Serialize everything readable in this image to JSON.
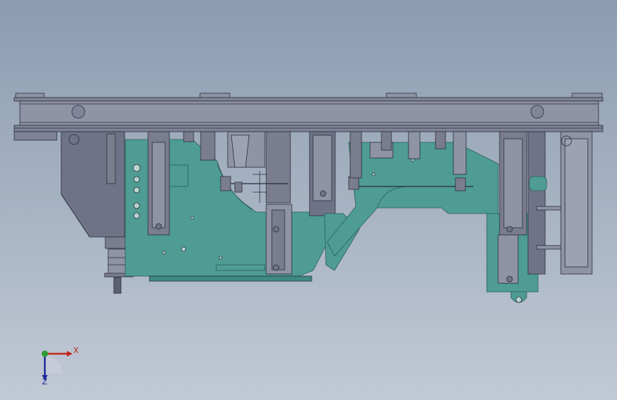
{
  "triad": {
    "x_label": "X",
    "z_label": "Z",
    "x_color": "#c0281e",
    "y_color": "#2f9a3a",
    "z_color": "#1e2a9a"
  },
  "colors": {
    "background_top": "#8b9cb1",
    "background_bottom": "#c1c9d4",
    "frame": "#8e93a6",
    "frame_dark": "#6f7388",
    "plate": "#4e9c94",
    "plate_edge": "#2c5c58",
    "steel": "#7a7d8e",
    "line": "#2a2d38"
  }
}
